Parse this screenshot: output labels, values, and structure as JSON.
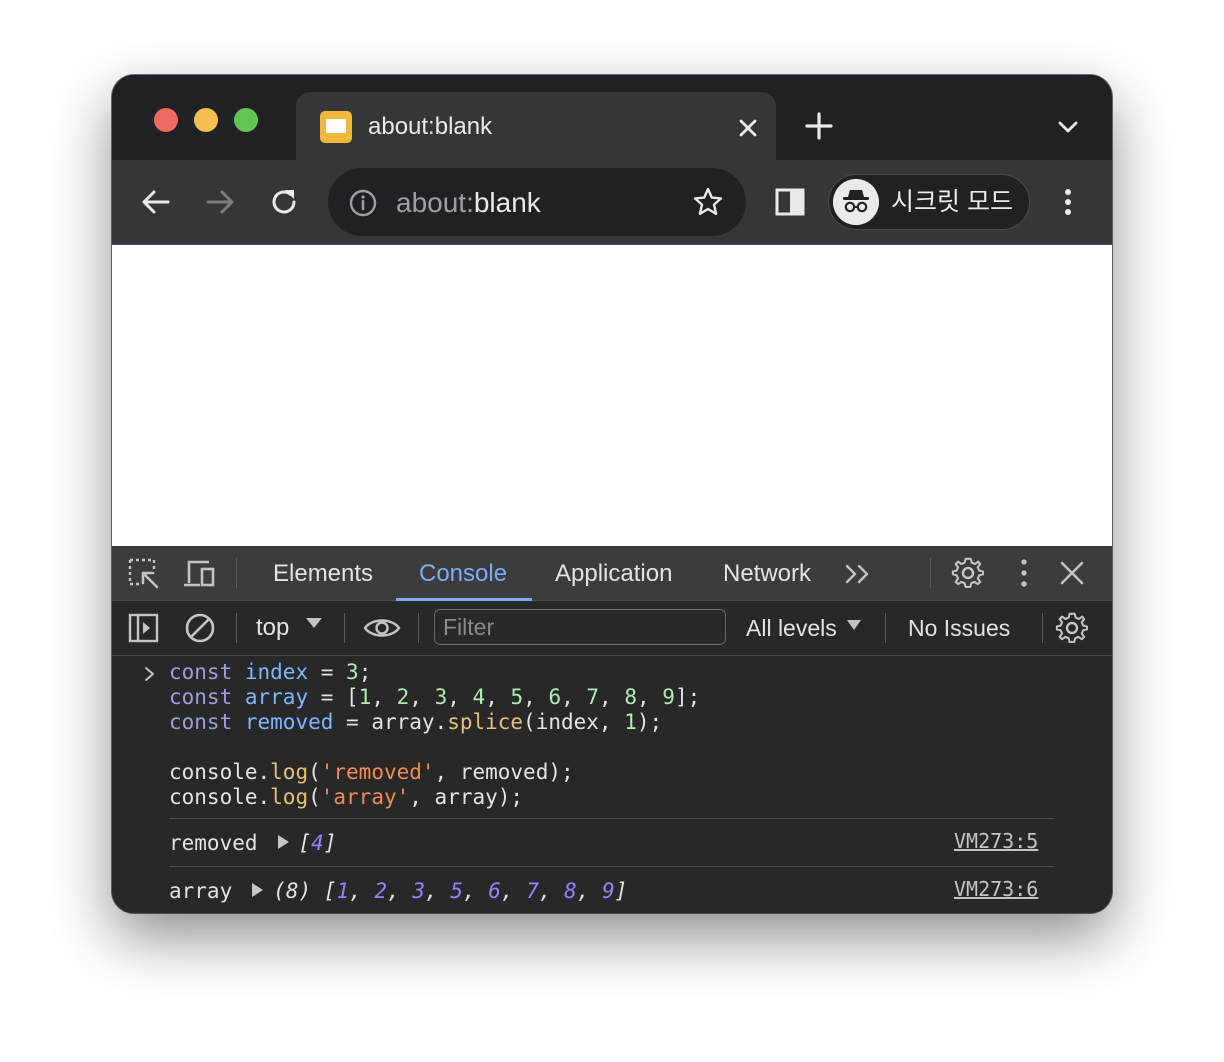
{
  "window": {
    "tab": {
      "title": "about:blank",
      "favicon": "blank-page-icon"
    },
    "new_tab_icon": "plus-icon",
    "tab_menu_icon": "chevron-down-icon"
  },
  "toolbar": {
    "back_icon": "arrow-left-icon",
    "forward_icon": "arrow-right-icon",
    "reload_icon": "reload-icon",
    "address": {
      "muted_part": "about:",
      "main_part": "blank",
      "info_icon": "info-icon",
      "star_icon": "star-icon"
    },
    "side_panel_icon": "side-panel-icon",
    "incognito": {
      "label": "시크릿 모드",
      "icon": "incognito-icon"
    },
    "menu_icon": "kebab-menu-icon"
  },
  "devtools": {
    "tabs": [
      {
        "label": "Elements",
        "active": false
      },
      {
        "label": "Console",
        "active": true
      },
      {
        "label": "Application",
        "active": false
      },
      {
        "label": "Network",
        "active": false
      }
    ],
    "more_tabs_icon": "double-chevron-icon",
    "console_toolbar": {
      "context": "top",
      "filter_placeholder": "Filter",
      "levels": "All levels",
      "issues": "No Issues"
    },
    "console": {
      "input": {
        "line1": {
          "kw": "const",
          "var": "index",
          "op": " = ",
          "num": "3",
          "end": ";"
        },
        "line2": {
          "kw": "const",
          "var": "array",
          "op": " = [",
          "nums": [
            "1",
            "2",
            "3",
            "4",
            "5",
            "6",
            "7",
            "8",
            "9"
          ],
          "end": "];"
        },
        "line3": {
          "kw": "const",
          "var": "removed",
          "op": " = array.",
          "fn": "splice",
          "args_open": "(index, ",
          "num": "1",
          "end": ");"
        },
        "line5": {
          "obj": "console.",
          "fn": "log",
          "open": "(",
          "str": "'removed'",
          "rest": ", removed);"
        },
        "line6": {
          "obj": "console.",
          "fn": "log",
          "open": "(",
          "str": "'array'",
          "rest": ", array);"
        }
      },
      "outputs": [
        {
          "label": "removed",
          "prefix": "",
          "open": "[",
          "items": [
            "4"
          ],
          "close": "]",
          "source": "VM273:5"
        },
        {
          "label": "array",
          "prefix": "(8) ",
          "open": "[",
          "items": [
            "1",
            "2",
            "3",
            "5",
            "6",
            "7",
            "8",
            "9"
          ],
          "close": "]",
          "source": "VM273:6"
        }
      ]
    }
  }
}
